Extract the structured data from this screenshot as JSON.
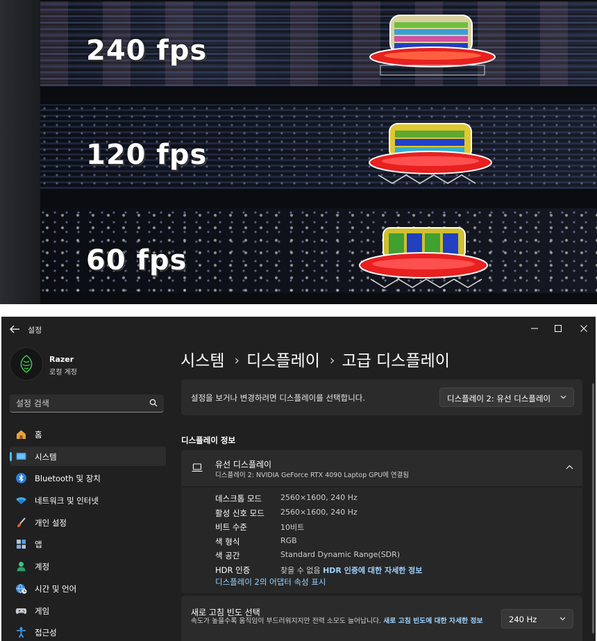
{
  "photo": {
    "labels": [
      "240 fps",
      "120 fps",
      "60 fps"
    ],
    "icon": "ufo-test-icon"
  },
  "window": {
    "title": "설정",
    "controls": [
      "minimize-icon",
      "maximize-icon",
      "close-icon"
    ]
  },
  "profile": {
    "name": "Razer",
    "subtitle": "로컬 계정",
    "icon": "razer-logo-icon"
  },
  "search": {
    "placeholder": "설정 검색"
  },
  "sidebar": {
    "items": [
      {
        "label": "홈",
        "icon": "home-icon"
      },
      {
        "label": "시스템",
        "icon": "monitor-icon",
        "active": true
      },
      {
        "label": "Bluetooth 및 장치",
        "icon": "bluetooth-icon"
      },
      {
        "label": "네트워크 및 인터넷",
        "icon": "wifi-icon"
      },
      {
        "label": "개인 설정",
        "icon": "brush-icon"
      },
      {
        "label": "앱",
        "icon": "apps-icon"
      },
      {
        "label": "계정",
        "icon": "account-icon"
      },
      {
        "label": "시간 및 언어",
        "icon": "globe-clock-icon"
      },
      {
        "label": "게임",
        "icon": "gamepad-icon"
      },
      {
        "label": "접근성",
        "icon": "accessibility-icon"
      }
    ]
  },
  "breadcrumb": {
    "items": [
      "시스템",
      "디스플레이",
      "고급 디스플레이"
    ],
    "separator": "›"
  },
  "select_display": {
    "text": "설정을 보거나 변경하려면 디스플레이를 선택합니다.",
    "value": "디스플레이 2: 유선 디스플레이"
  },
  "display_info": {
    "section_title": "디스플레이 정보",
    "name": "유선 디스플레이",
    "connection": "디스플레이 2: NVIDIA GeForce RTX 4090 Laptop GPU에 연결됨",
    "rows": [
      {
        "label": "데스크톱 모드",
        "value": "2560×1600, 240 Hz"
      },
      {
        "label": "활성 신호 모드",
        "value": "2560×1600, 240 Hz"
      },
      {
        "label": "비트 수준",
        "value": "10비트"
      },
      {
        "label": "색 형식",
        "value": "RGB"
      },
      {
        "label": "색 공간",
        "value": "Standard Dynamic Range(SDR)"
      },
      {
        "label": "HDR 인증",
        "value": "찾을 수 없음",
        "link": "HDR 인증에 대한 자세한 정보"
      }
    ],
    "adapter_link": "디스플레이 2의 어댑터 속성 표시"
  },
  "refresh_rate": {
    "title": "새로 고침 빈도 선택",
    "description": "속도가 높을수록 움직임이 부드러워지지만 전력 소모도 늘어납니다.",
    "link": "새로 고침 빈도에 대한 자세한 정보",
    "value": "240 Hz"
  },
  "colors": {
    "accent": "#4cc2ff",
    "link": "#9ad2ff",
    "window_bg": "#202020",
    "card_bg": "#2b2b2b"
  }
}
